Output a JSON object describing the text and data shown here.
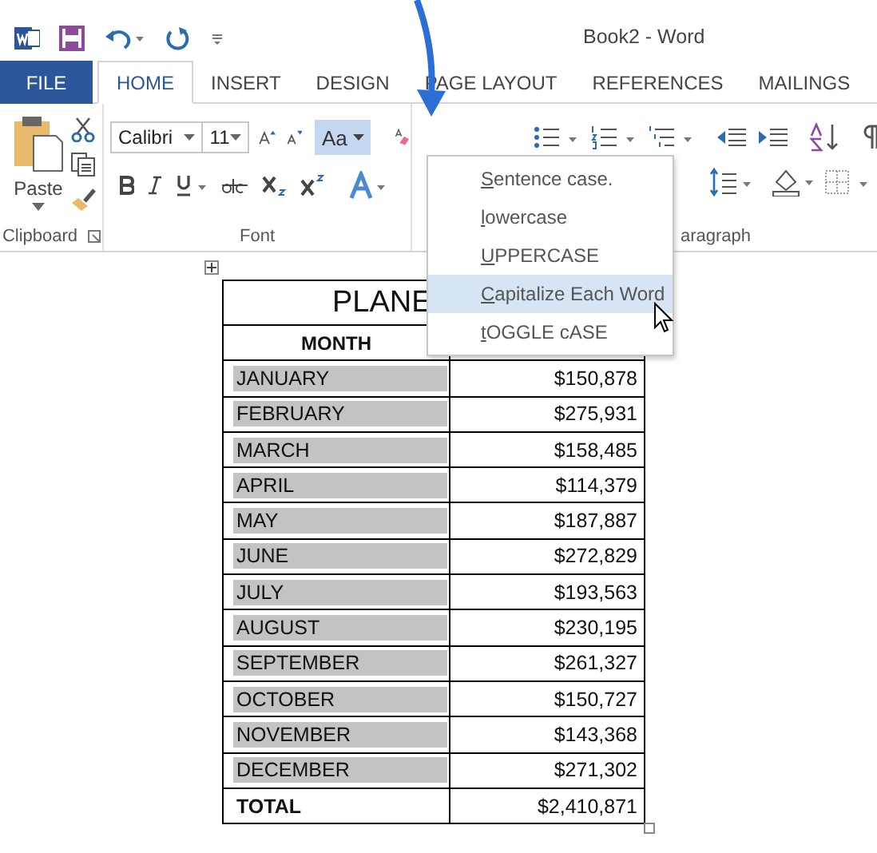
{
  "window": {
    "title": "Book2 - Word"
  },
  "tabs": [
    {
      "label": "FILE",
      "kind": "file",
      "selected": false
    },
    {
      "label": "HOME",
      "kind": "tab",
      "selected": true
    },
    {
      "label": "INSERT",
      "kind": "tab",
      "selected": false
    },
    {
      "label": "DESIGN",
      "kind": "tab",
      "selected": false
    },
    {
      "label": "PAGE LAYOUT",
      "kind": "tab",
      "selected": false
    },
    {
      "label": "REFERENCES",
      "kind": "tab",
      "selected": false
    },
    {
      "label": "MAILINGS",
      "kind": "tab",
      "selected": false
    }
  ],
  "ribbon": {
    "clipboard": {
      "label": "Clipboard",
      "paste": "Paste"
    },
    "font": {
      "label": "Font",
      "font_name": "Calibri",
      "font_size": "11",
      "change_case": "Aa",
      "change_case_open": true
    },
    "paragraph": {
      "label": "aragraph"
    }
  },
  "case_menu": {
    "items": [
      {
        "label": "Sentence case.",
        "selected": false
      },
      {
        "label": "lowercase",
        "selected": false
      },
      {
        "label": "UPPERCASE",
        "selected": false
      },
      {
        "label": "Capitalize Each Word",
        "selected": true
      },
      {
        "label": "tOGGLE cASE",
        "selected": false
      }
    ]
  },
  "table": {
    "title": "PLANE",
    "header": "MONTH",
    "rows": [
      {
        "kind": "month",
        "month": "JANUARY",
        "amount": "$150,878",
        "highlighted": true
      },
      {
        "kind": "month",
        "month": "FEBRUARY",
        "amount": "$275,931",
        "highlighted": true
      },
      {
        "kind": "month",
        "month": "MARCH",
        "amount": "$158,485",
        "highlighted": true
      },
      {
        "kind": "month",
        "month": "APRIL",
        "amount": "$114,379",
        "highlighted": true
      },
      {
        "kind": "month",
        "month": "MAY",
        "amount": "$187,887",
        "highlighted": true
      },
      {
        "kind": "month",
        "month": "JUNE",
        "amount": "$272,829",
        "highlighted": true
      },
      {
        "kind": "month",
        "month": "JULY",
        "amount": "$193,563",
        "highlighted": true
      },
      {
        "kind": "month",
        "month": "AUGUST",
        "amount": "$230,195",
        "highlighted": true
      },
      {
        "kind": "month",
        "month": "SEPTEMBER",
        "amount": "$261,327",
        "highlighted": true
      },
      {
        "kind": "month",
        "month": "OCTOBER",
        "amount": "$150,727",
        "highlighted": true
      },
      {
        "kind": "month",
        "month": "NOVEMBER",
        "amount": "$143,368",
        "highlighted": true
      },
      {
        "kind": "month",
        "month": "DECEMBER",
        "amount": "$271,302",
        "highlighted": true
      },
      {
        "kind": "total",
        "month": "TOTAL",
        "amount": "$2,410,871",
        "highlighted": false
      }
    ]
  }
}
